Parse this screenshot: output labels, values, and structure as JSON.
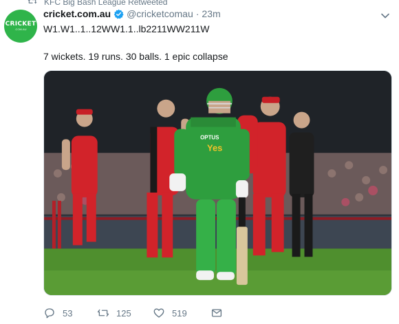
{
  "retweet_context": {
    "label": "KFC Big Bash League Retweeted",
    "icon": "retweet-icon"
  },
  "author": {
    "name": "cricket.com.au",
    "handle": "@cricketcomau",
    "separator": "·",
    "time": "23m",
    "avatar_text": "CRICKET",
    "avatar_sub": ".COM.AU",
    "verified": true,
    "avatar_color": "#2fb44a"
  },
  "tweet": {
    "line1": "W1.W1..1..12WW1.1..lb2211WW211W",
    "line2": "7 wickets. 19 runs. 30 balls. 1 epic collapse"
  },
  "media": {
    "type": "photo",
    "subject": "cricket batsman walking off field",
    "shirt_text_1": "OPTUS",
    "shirt_text_2": "Yes",
    "colors": {
      "green_kit": "#2e9e3e",
      "red_kit": "#d2232a",
      "grass": "#4f8f2e"
    }
  },
  "actions": {
    "reply_count": "53",
    "retweet_count": "125",
    "like_count": "519"
  },
  "colors": {
    "text": "#14171a",
    "muted": "#657786",
    "verified_blue": "#1da1f2"
  }
}
